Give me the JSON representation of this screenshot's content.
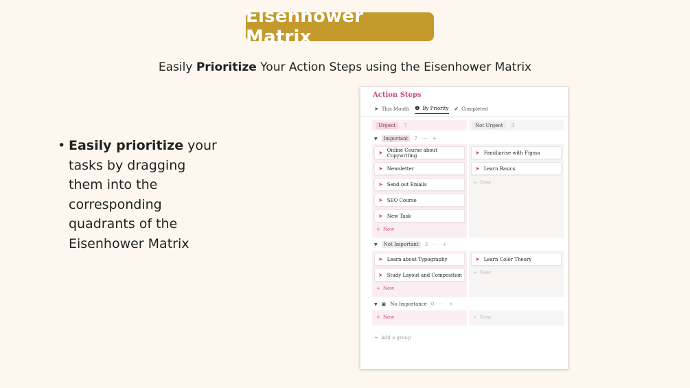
{
  "header": {
    "title": "Eisenhower Matrix",
    "subtitle_pre": "Easily ",
    "subtitle_bold": "Prioritize",
    "subtitle_post": " Your Action Steps using the Eisenhower Matrix"
  },
  "bullet": {
    "bold": "Easily prioritize",
    "rest": " your tasks by dragging them into the corresponding quadrants of the Eisenhower Matrix"
  },
  "board": {
    "title": "Action Steps",
    "tabs": [
      {
        "label": "This Month",
        "icon": "cursor-icon"
      },
      {
        "label": "By Priority",
        "icon": "priority-icon",
        "active": true
      },
      {
        "label": "Completed",
        "icon": "check-circle-icon"
      }
    ],
    "columns": [
      {
        "label": "Urgent",
        "count": "7"
      },
      {
        "label": "Not Urgent",
        "count": "3"
      }
    ],
    "groups": [
      {
        "label": "Important",
        "count": "7",
        "urgent": [
          "Online Course about Copywriting",
          "Newsletter",
          "Send out Emails",
          "SEO Course",
          "New Task"
        ],
        "not_urgent": [
          "Familiarise with Figma",
          "Learn Basics"
        ]
      },
      {
        "label": "Not Important",
        "count": "3",
        "urgent": [
          "Learn about Typography",
          "Study Layout and Composition"
        ],
        "not_urgent": [
          "Learn Color Theory"
        ]
      },
      {
        "label": "No Importance",
        "count": "0",
        "urgent": [],
        "not_urgent": []
      }
    ],
    "new_label": "New",
    "add_group_label": "Add a group",
    "group_actions": "···",
    "plus": "+"
  },
  "colors": {
    "title_bg": "#c49a2c",
    "page_bg": "#fdf7ef",
    "accent_pink": "#c7497a"
  }
}
